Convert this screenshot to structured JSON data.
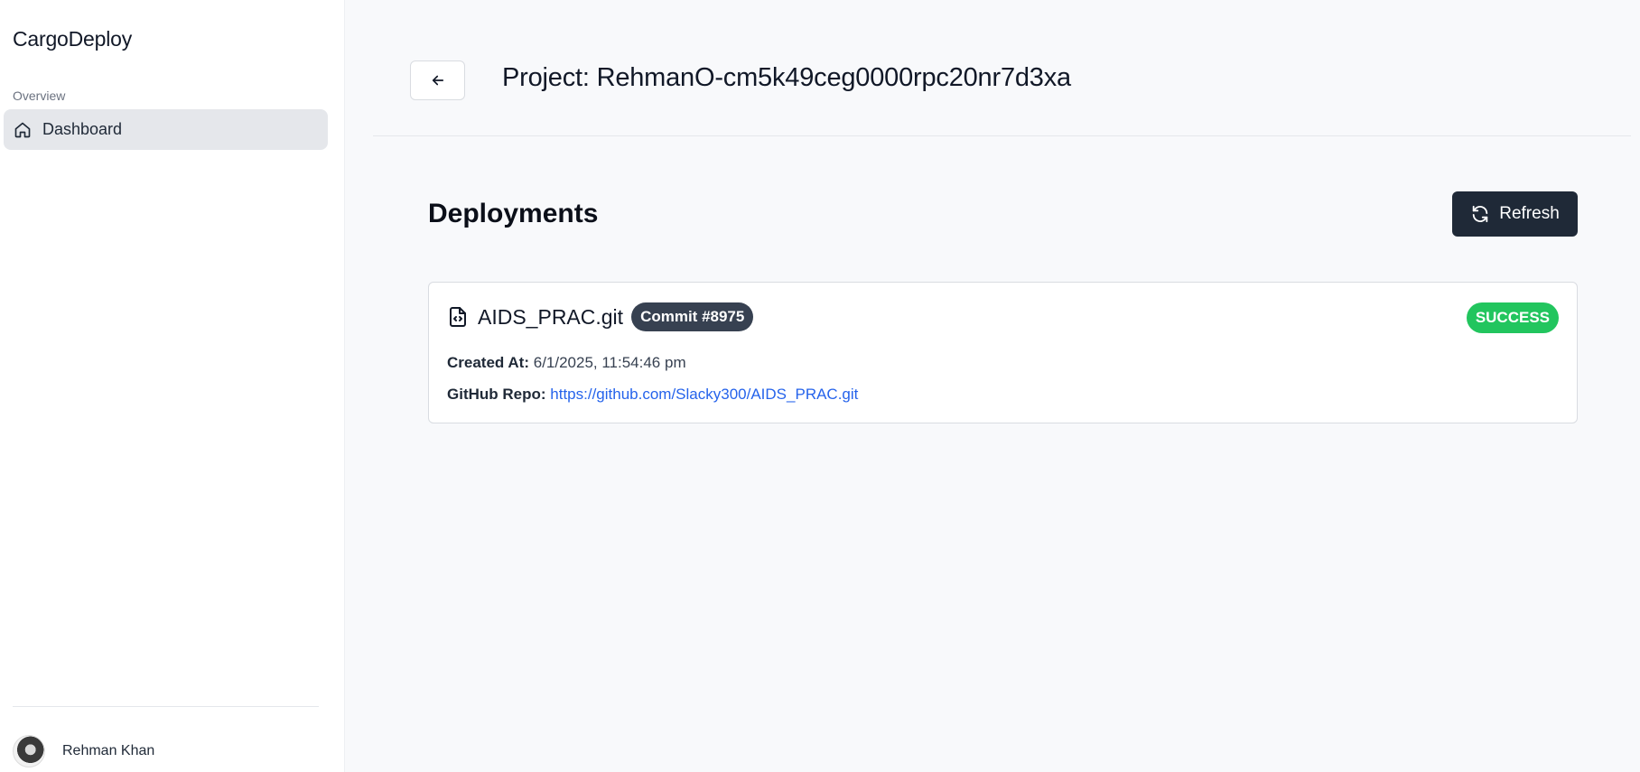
{
  "sidebar": {
    "brand": "CargoDeploy",
    "section_label": "Overview",
    "items": [
      {
        "label": "Dashboard",
        "icon": "home-icon"
      }
    ],
    "user": {
      "name": "Rehman Khan"
    }
  },
  "header": {
    "title": "Project: RehmanO-cm5k49ceg0000rpc20nr7d3xa",
    "back_icon": "arrow-left-icon"
  },
  "deployments": {
    "title": "Deployments",
    "refresh_label": "Refresh",
    "items": [
      {
        "repo_name": "AIDS_PRAC.git",
        "commit": "Commit #8975",
        "status": "SUCCESS",
        "created_at_label": "Created At:",
        "created_at": "6/1/2025, 11:54:46 pm",
        "github_repo_label": "GitHub Repo:",
        "github_repo": "https://github.com/Slacky300/AIDS_PRAC.git"
      }
    ]
  },
  "colors": {
    "primary_button": "#1f2937",
    "success": "#22c55e",
    "link": "#2563eb",
    "badge": "#374151"
  }
}
